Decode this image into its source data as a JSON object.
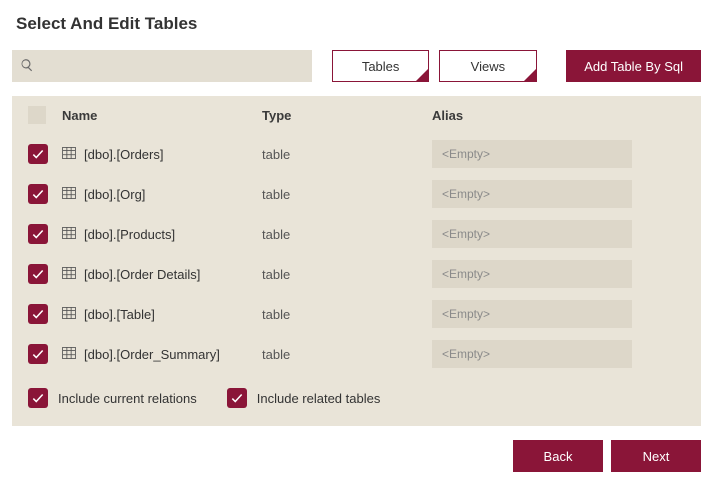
{
  "title": "Select And Edit Tables",
  "search": {
    "value": "",
    "placeholder": ""
  },
  "tabs": {
    "tables": "Tables",
    "views": "Views"
  },
  "add_sql_label": "Add Table By Sql",
  "columns": {
    "name": "Name",
    "type": "Type",
    "alias": "Alias"
  },
  "alias_placeholder": "<Empty>",
  "rows": [
    {
      "name": "[dbo].[Orders]",
      "type": "table",
      "alias": ""
    },
    {
      "name": "[dbo].[Org]",
      "type": "table",
      "alias": ""
    },
    {
      "name": "[dbo].[Products]",
      "type": "table",
      "alias": ""
    },
    {
      "name": "[dbo].[Order Details]",
      "type": "table",
      "alias": ""
    },
    {
      "name": "[dbo].[Table]",
      "type": "table",
      "alias": ""
    },
    {
      "name": "[dbo].[Order_Summary]",
      "type": "table",
      "alias": ""
    }
  ],
  "options": {
    "include_relations": "Include current relations",
    "include_related": "Include related tables"
  },
  "footer": {
    "back": "Back",
    "next": "Next"
  },
  "colors": {
    "accent": "#8a1538",
    "panel": "#e9e4d8",
    "field": "#ddd7c9"
  }
}
